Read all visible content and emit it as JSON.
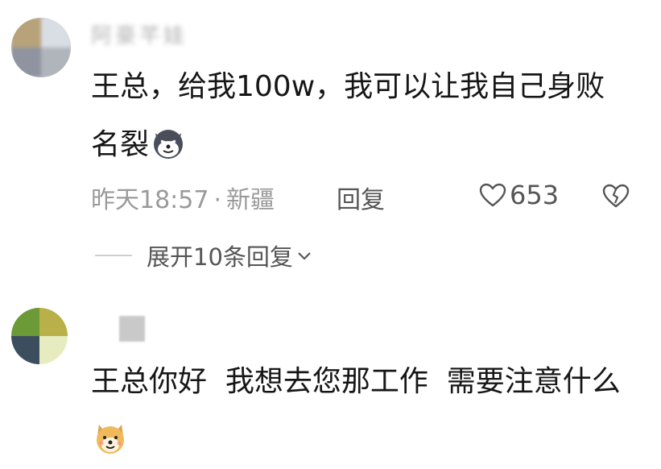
{
  "comments": [
    {
      "username": "阿豪芊娃",
      "text": "王总，给我100w，我可以让我自己身败名裂",
      "emoji": "husky-emoji",
      "time": "昨天18:57",
      "separator": "·",
      "location": "新疆",
      "reply_label": "回复",
      "likes": "653",
      "expand_label": "展开10条回复"
    },
    {
      "text": "王总你好  我想去您那工作  需要注意什么",
      "emoji": "doge-emoji"
    }
  ],
  "colors": {
    "text": "#161616",
    "meta": "#9a9a9a",
    "action": "#555555"
  }
}
